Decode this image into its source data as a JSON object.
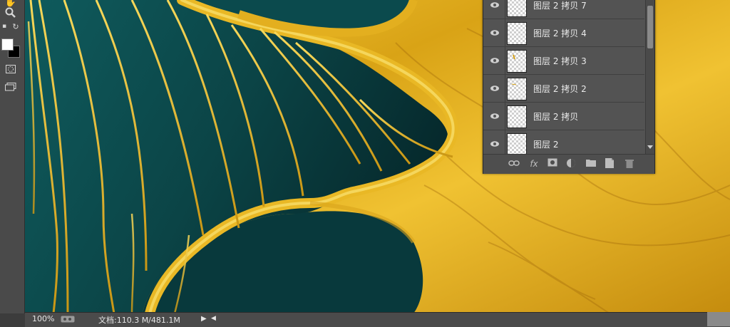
{
  "statusbar": {
    "zoom": "100%",
    "doc_size": "文档:110.3 M/481.1M"
  },
  "layers": [
    {
      "name": "图层 2 拷贝 7",
      "visible": true
    },
    {
      "name": "图层 2 拷贝 4",
      "visible": true
    },
    {
      "name": "图层 2 拷贝 3",
      "visible": true
    },
    {
      "name": "图层 2 拷贝 2",
      "visible": true
    },
    {
      "name": "图层 2 拷贝",
      "visible": true
    },
    {
      "name": "图层 2",
      "visible": true
    }
  ],
  "layer_footer": {
    "icons": [
      "link-icon",
      "fx-icon",
      "mask-icon",
      "adjustment-icon",
      "folder-icon",
      "new-layer-icon",
      "trash-icon"
    ]
  },
  "toolbar": {
    "tools": [
      "hand-icon",
      "zoom-icon",
      "swap-colors-icon",
      "foreground-color",
      "background-color",
      "quick-mask-icon",
      "screen-mode-icon"
    ]
  },
  "colors": {
    "teal_dark": "#0c3a3e",
    "teal_light": "#0f5759",
    "gold": "#e8b51f",
    "gold_dark": "#b07a0c"
  }
}
